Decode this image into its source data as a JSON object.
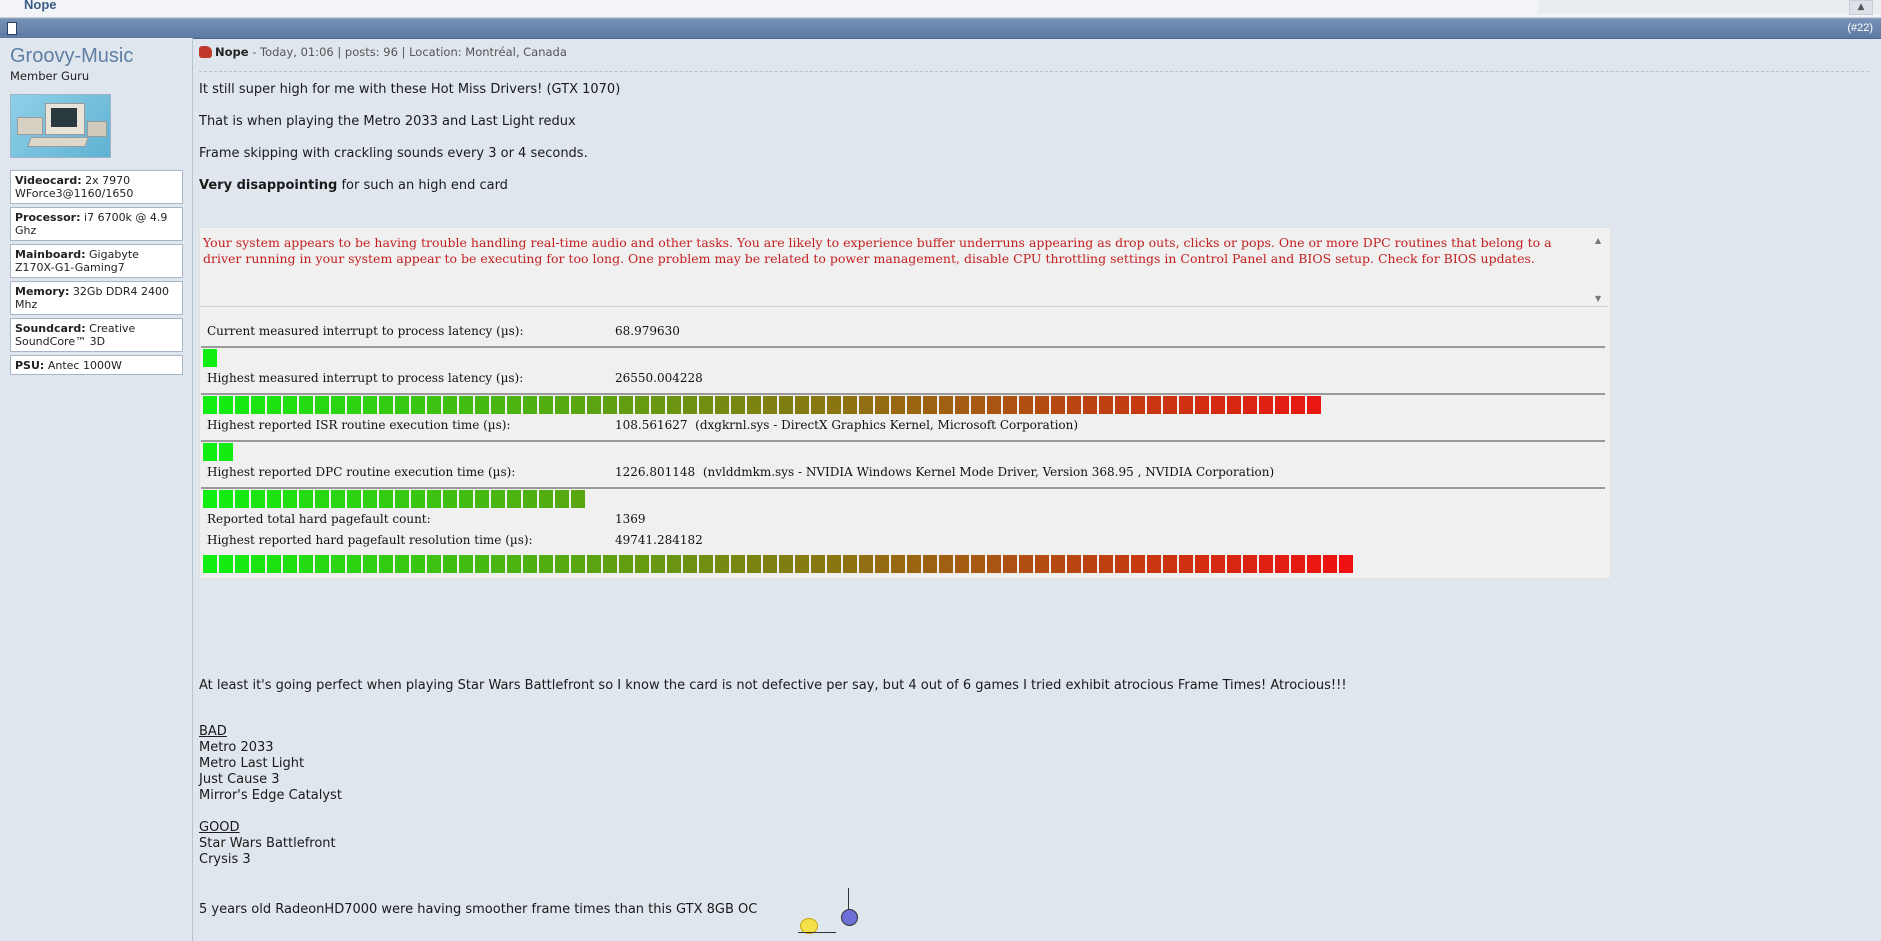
{
  "topbar": {
    "title": "Nope",
    "up_icon": "chevron-up-icon"
  },
  "postbar": {
    "post_number": "(#22)",
    "doc_icon": "document-icon"
  },
  "user": {
    "name": "Groovy-Music",
    "title": "Member Guru",
    "specs": [
      {
        "label": "Videocard:",
        "value": "2x 7970 WForce3@1160/1650"
      },
      {
        "label": "Processor:",
        "value": "i7 6700k @ 4.9 Ghz"
      },
      {
        "label": "Mainboard:",
        "value": "Gigabyte Z170X-G1-Gaming7"
      },
      {
        "label": "Memory:",
        "value": "32Gb DDR4 2400 Mhz"
      },
      {
        "label": "Soundcard:",
        "value": "Creative SoundCore™ 3D"
      },
      {
        "label": "PSU:",
        "value": "Antec 1000W"
      }
    ]
  },
  "post": {
    "status_icon": "thumbs-down-icon",
    "title": "Nope",
    "meta": " - Today, 01:06 | posts: 96 | Location: Montréal, Canada",
    "p1": "It still super high for me with these Hot Miss Drivers! (GTX 1070)",
    "p2": "That is when playing the Metro 2033 and Last Light redux",
    "p3": "Frame skipping with crackling sounds every 3 or 4 seconds.",
    "p4_bold": "Very disappointing",
    "p4_rest": " for such an high end card",
    "latency": {
      "warning": "Your system appears to be having trouble handling real-time audio and other tasks. You are likely to experience buffer underruns appearing as drop outs, clicks or pops. One or more DPC routines that belong to a driver running in your system appear to be executing for too long. One problem may be related to power management, disable CPU throttling settings in Control Panel and BIOS setup. Check for BIOS updates.",
      "rows": [
        {
          "label": "Current measured interrupt to process latency (µs):",
          "value": "68.979630",
          "extra": "",
          "bar_fraction": 0.02
        },
        {
          "label": "Highest measured interrupt to process latency (µs):",
          "value": "26550.004228",
          "extra": "",
          "bar_fraction": 0.97
        },
        {
          "label": "Highest reported ISR routine execution time (µs):",
          "value": "108.561627",
          "extra": "(dxgkrnl.sys - DirectX Graphics Kernel, Microsoft Corporation)",
          "bar_fraction": 0.03
        },
        {
          "label": "Highest reported DPC routine execution time (µs):",
          "value": "1226.801148",
          "extra": "(nvlddmkm.sys - NVIDIA Windows Kernel Mode Driver, Version 368.95 , NVIDIA Corporation)",
          "bar_fraction": 0.34
        }
      ],
      "pagefault_count_label": "Reported total hard pagefault count:",
      "pagefault_count_value": "1369",
      "pagefault_time_label": "Highest reported hard pagefault resolution time (µs):",
      "pagefault_time_value": "49741.284182",
      "pagefault_bar_fraction": 1.0
    },
    "p5": "At least it's going perfect when playing Star Wars Battlefront so I know the card is not defective per say, but 4 out of 6 games I tried exhibit atrocious Frame Times! Atrocious!!!",
    "bad_heading": "BAD",
    "bad_list": [
      "Metro 2033",
      "Metro Last Light",
      "Just Cause 3",
      "Mirror's Edge Catalyst"
    ],
    "good_heading": "GOOD",
    "good_list": [
      "Star Wars Battlefront",
      "Crysis 3"
    ],
    "p6": "5 years old RadeonHD7000 were having smoother frame times than this GTX 8GB OC",
    "emoticon": "smiley-ball-icon"
  },
  "colors": {
    "accent": "#5d7aa3",
    "warning_text": "#c42020",
    "bar_green": "#11ee11",
    "bar_red": "#ee1111"
  }
}
